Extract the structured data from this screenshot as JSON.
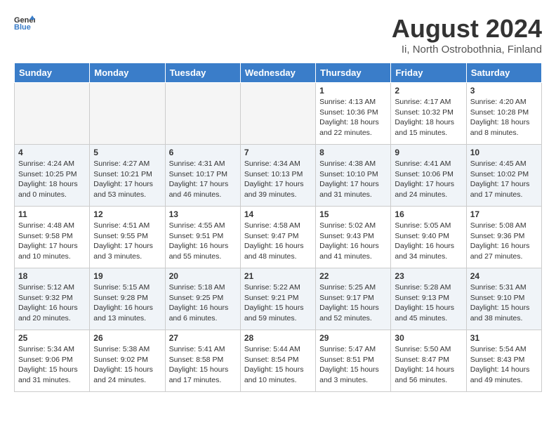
{
  "header": {
    "logo_general": "General",
    "logo_blue": "Blue",
    "title": "August 2024",
    "location": "Ii, North Ostrobothnia, Finland"
  },
  "days_of_week": [
    "Sunday",
    "Monday",
    "Tuesday",
    "Wednesday",
    "Thursday",
    "Friday",
    "Saturday"
  ],
  "weeks": [
    [
      {
        "day": "",
        "info": ""
      },
      {
        "day": "",
        "info": ""
      },
      {
        "day": "",
        "info": ""
      },
      {
        "day": "",
        "info": ""
      },
      {
        "day": "1",
        "info": "Sunrise: 4:13 AM\nSunset: 10:36 PM\nDaylight: 18 hours\nand 22 minutes."
      },
      {
        "day": "2",
        "info": "Sunrise: 4:17 AM\nSunset: 10:32 PM\nDaylight: 18 hours\nand 15 minutes."
      },
      {
        "day": "3",
        "info": "Sunrise: 4:20 AM\nSunset: 10:28 PM\nDaylight: 18 hours\nand 8 minutes."
      }
    ],
    [
      {
        "day": "4",
        "info": "Sunrise: 4:24 AM\nSunset: 10:25 PM\nDaylight: 18 hours\nand 0 minutes."
      },
      {
        "day": "5",
        "info": "Sunrise: 4:27 AM\nSunset: 10:21 PM\nDaylight: 17 hours\nand 53 minutes."
      },
      {
        "day": "6",
        "info": "Sunrise: 4:31 AM\nSunset: 10:17 PM\nDaylight: 17 hours\nand 46 minutes."
      },
      {
        "day": "7",
        "info": "Sunrise: 4:34 AM\nSunset: 10:13 PM\nDaylight: 17 hours\nand 39 minutes."
      },
      {
        "day": "8",
        "info": "Sunrise: 4:38 AM\nSunset: 10:10 PM\nDaylight: 17 hours\nand 31 minutes."
      },
      {
        "day": "9",
        "info": "Sunrise: 4:41 AM\nSunset: 10:06 PM\nDaylight: 17 hours\nand 24 minutes."
      },
      {
        "day": "10",
        "info": "Sunrise: 4:45 AM\nSunset: 10:02 PM\nDaylight: 17 hours\nand 17 minutes."
      }
    ],
    [
      {
        "day": "11",
        "info": "Sunrise: 4:48 AM\nSunset: 9:58 PM\nDaylight: 17 hours\nand 10 minutes."
      },
      {
        "day": "12",
        "info": "Sunrise: 4:51 AM\nSunset: 9:55 PM\nDaylight: 17 hours\nand 3 minutes."
      },
      {
        "day": "13",
        "info": "Sunrise: 4:55 AM\nSunset: 9:51 PM\nDaylight: 16 hours\nand 55 minutes."
      },
      {
        "day": "14",
        "info": "Sunrise: 4:58 AM\nSunset: 9:47 PM\nDaylight: 16 hours\nand 48 minutes."
      },
      {
        "day": "15",
        "info": "Sunrise: 5:02 AM\nSunset: 9:43 PM\nDaylight: 16 hours\nand 41 minutes."
      },
      {
        "day": "16",
        "info": "Sunrise: 5:05 AM\nSunset: 9:40 PM\nDaylight: 16 hours\nand 34 minutes."
      },
      {
        "day": "17",
        "info": "Sunrise: 5:08 AM\nSunset: 9:36 PM\nDaylight: 16 hours\nand 27 minutes."
      }
    ],
    [
      {
        "day": "18",
        "info": "Sunrise: 5:12 AM\nSunset: 9:32 PM\nDaylight: 16 hours\nand 20 minutes."
      },
      {
        "day": "19",
        "info": "Sunrise: 5:15 AM\nSunset: 9:28 PM\nDaylight: 16 hours\nand 13 minutes."
      },
      {
        "day": "20",
        "info": "Sunrise: 5:18 AM\nSunset: 9:25 PM\nDaylight: 16 hours\nand 6 minutes."
      },
      {
        "day": "21",
        "info": "Sunrise: 5:22 AM\nSunset: 9:21 PM\nDaylight: 15 hours\nand 59 minutes."
      },
      {
        "day": "22",
        "info": "Sunrise: 5:25 AM\nSunset: 9:17 PM\nDaylight: 15 hours\nand 52 minutes."
      },
      {
        "day": "23",
        "info": "Sunrise: 5:28 AM\nSunset: 9:13 PM\nDaylight: 15 hours\nand 45 minutes."
      },
      {
        "day": "24",
        "info": "Sunrise: 5:31 AM\nSunset: 9:10 PM\nDaylight: 15 hours\nand 38 minutes."
      }
    ],
    [
      {
        "day": "25",
        "info": "Sunrise: 5:34 AM\nSunset: 9:06 PM\nDaylight: 15 hours\nand 31 minutes."
      },
      {
        "day": "26",
        "info": "Sunrise: 5:38 AM\nSunset: 9:02 PM\nDaylight: 15 hours\nand 24 minutes."
      },
      {
        "day": "27",
        "info": "Sunrise: 5:41 AM\nSunset: 8:58 PM\nDaylight: 15 hours\nand 17 minutes."
      },
      {
        "day": "28",
        "info": "Sunrise: 5:44 AM\nSunset: 8:54 PM\nDaylight: 15 hours\nand 10 minutes."
      },
      {
        "day": "29",
        "info": "Sunrise: 5:47 AM\nSunset: 8:51 PM\nDaylight: 15 hours\nand 3 minutes."
      },
      {
        "day": "30",
        "info": "Sunrise: 5:50 AM\nSunset: 8:47 PM\nDaylight: 14 hours\nand 56 minutes."
      },
      {
        "day": "31",
        "info": "Sunrise: 5:54 AM\nSunset: 8:43 PM\nDaylight: 14 hours\nand 49 minutes."
      }
    ]
  ]
}
